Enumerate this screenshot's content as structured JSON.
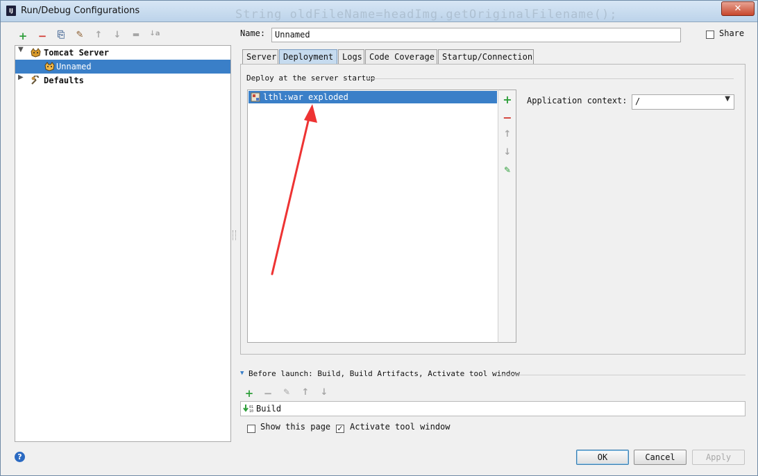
{
  "window": {
    "title": "Run/Debug Configurations",
    "background_text": "String oldFileName=headImg.getOriginalFilename();",
    "close_label": "✕"
  },
  "toolbar": {
    "add": "+",
    "remove": "−",
    "copy": "⎘",
    "edit_defaults": "✎",
    "move_up": "↑",
    "move_down": "↓",
    "folder": "▬",
    "sort": "↓a"
  },
  "tree": {
    "items": [
      {
        "label": "Tomcat Server",
        "expanded": true,
        "icon": "tomcat-icon"
      },
      {
        "label": "Unnamed",
        "selected": true,
        "icon": "tomcat-icon"
      },
      {
        "label": "Defaults",
        "expanded": false,
        "icon": "wrench-icon"
      }
    ]
  },
  "form": {
    "name_label": "Name:",
    "name_value": "Unnamed",
    "share_label": "Share",
    "share_checked": false
  },
  "tabs": [
    {
      "label": "Server"
    },
    {
      "label": "Deployment",
      "active": true
    },
    {
      "label": "Logs"
    },
    {
      "label": "Code Coverage"
    },
    {
      "label": "Startup/Connection"
    }
  ],
  "deployment": {
    "group_title": "Deploy at the server startup",
    "items": [
      {
        "label": "lthl:war exploded",
        "icon": "artifact-icon"
      }
    ],
    "tools": {
      "add": "+",
      "remove": "−",
      "up": "↑",
      "down": "↓",
      "edit": "✎"
    },
    "context_label": "Application context:",
    "context_value": "/"
  },
  "before_launch": {
    "title": "Before launch: Build, Build Artifacts, Activate tool window",
    "items": [
      {
        "label": "Build",
        "icon": "build-icon"
      }
    ],
    "tools": {
      "add": "+",
      "remove": "−",
      "edit": "✎",
      "up": "↑",
      "down": "↓"
    },
    "show_page_label": "Show this page",
    "show_page_checked": false,
    "activate_label": "Activate tool window",
    "activate_checked": true
  },
  "buttons": {
    "ok": "OK",
    "cancel": "Cancel",
    "apply": "Apply",
    "help": "?"
  },
  "colors": {
    "selection": "#3a7fc8",
    "annotation_arrow": "#ee3333",
    "add_green": "#2e9e3a",
    "remove_red": "#d23b33"
  }
}
